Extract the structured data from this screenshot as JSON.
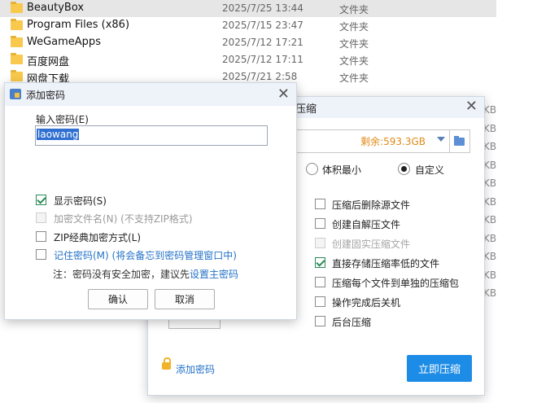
{
  "files": [
    {
      "name": "BeautyBox",
      "date": "2025/7/25 13:44",
      "type": "文件夹",
      "selected": true
    },
    {
      "name": "Program Files (x86)",
      "date": "2025/7/15 23:47",
      "type": "文件夹"
    },
    {
      "name": "WeGameApps",
      "date": "2025/7/12 17:21",
      "type": "文件夹"
    },
    {
      "name": "百度网盘",
      "date": "2025/7/12 17:11",
      "type": "文件夹"
    },
    {
      "name": "网盘下载",
      "date": "2025/7/21 2:58",
      "type": "文件夹"
    }
  ],
  "size_column_suffix": "KB",
  "compress": {
    "title": "压缩",
    "free_space": "剩余:593.3GB",
    "mode_min": "体积最小",
    "mode_custom": "自定义",
    "options": [
      {
        "label": "压缩后删除源文件",
        "checked": false,
        "disabled": false
      },
      {
        "label": "创建自解压文件",
        "checked": false,
        "disabled": false
      },
      {
        "label": "创建固实压缩文件",
        "checked": false,
        "disabled": true
      },
      {
        "label": "直接存储压缩率低的文件",
        "checked": true,
        "disabled": false
      },
      {
        "label": "压缩每个文件到单独的压缩包",
        "checked": false,
        "disabled": false
      },
      {
        "label": "操作完成后关机",
        "checked": false,
        "disabled": false
      },
      {
        "label": "后台压缩",
        "checked": false,
        "disabled": false
      }
    ],
    "add_password": "添加密码",
    "start": "立即压缩"
  },
  "password_dialog": {
    "title": "添加密码",
    "input_label": "输入密码(E)",
    "input_value": "laowang",
    "options": [
      {
        "label": "显示密码(S)",
        "checked": true,
        "disabled": false,
        "link": false
      },
      {
        "label": "加密文件名(N) (不支持ZIP格式)",
        "checked": false,
        "disabled": true,
        "link": false
      },
      {
        "label": "ZIP经典加密方式(L)",
        "checked": false,
        "disabled": false,
        "link": false
      },
      {
        "label": "记住密码(M) (将会备忘到密码管理窗口中)",
        "checked": false,
        "disabled": false,
        "link": true
      }
    ],
    "note_prefix": "注：密码没有安全加密，建议先",
    "note_link": "设置主密码",
    "ok": "确认",
    "cancel": "取消"
  }
}
